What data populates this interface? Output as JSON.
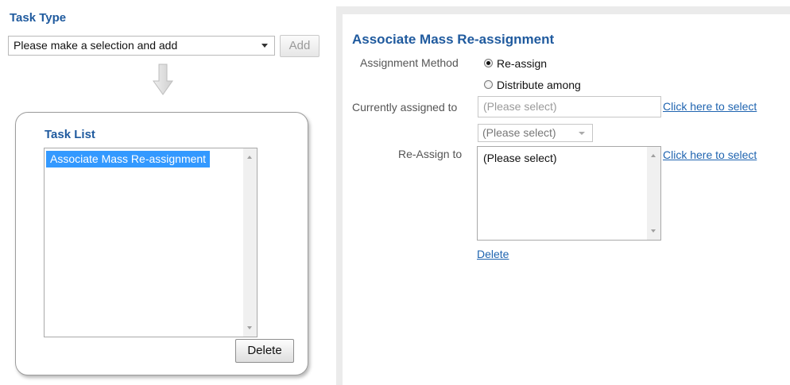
{
  "task_type": {
    "title": "Task Type",
    "select_value": "Please make a selection and add",
    "add_label": "Add"
  },
  "task_list": {
    "title": "Task List",
    "items": [
      "Associate Mass Re-assignment"
    ],
    "delete_label": "Delete"
  },
  "detail": {
    "title": "Associate Mass Re-assignment",
    "assignment_method_label": "Assignment Method",
    "radio_options": [
      {
        "label": "Re-assign",
        "checked": true
      },
      {
        "label": "Distribute among",
        "checked": false
      }
    ],
    "currently_assigned_label": "Currently assigned to",
    "currently_assigned_placeholder": "(Please select)",
    "click_select_link": "Click here to select",
    "small_select_value": "(Please select)",
    "reassign_label": "Re-Assign to",
    "reassign_items": [
      "(Please select)"
    ],
    "reassign_link": "Click here to select",
    "delete_link": "Delete"
  },
  "colors": {
    "heading": "#1f5a9e",
    "selection": "#3399ff",
    "link": "#1f64b0"
  }
}
